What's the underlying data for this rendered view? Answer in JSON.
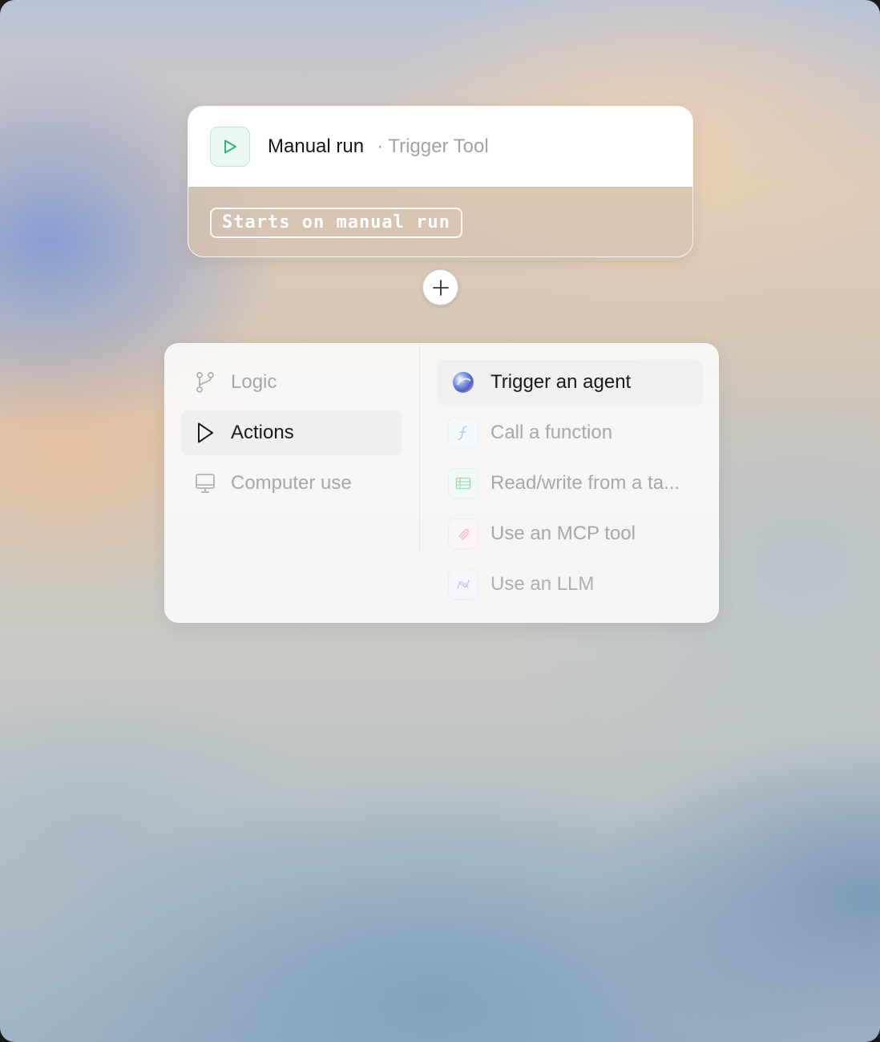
{
  "trigger": {
    "title": "Manual run",
    "separator": "·",
    "subtitle": "Trigger Tool",
    "description": "Starts on manual run",
    "icon": "play-icon",
    "accent_color": "#2bb67d"
  },
  "add_step": {
    "icon": "plus-icon"
  },
  "menu": {
    "categories": [
      {
        "label": "Logic",
        "icon": "branch-icon",
        "active": false
      },
      {
        "label": "Actions",
        "icon": "play-outline-icon",
        "active": true
      },
      {
        "label": "Computer use",
        "icon": "monitor-icon",
        "active": false
      }
    ],
    "actions": [
      {
        "label": "Trigger an agent",
        "icon": "agent-orb-icon",
        "active": true
      },
      {
        "label": "Call a function",
        "icon": "function-icon",
        "color": "#5aa9e6"
      },
      {
        "label": "Read/write from a ta...",
        "icon": "table-icon",
        "color": "#3fbf7f"
      },
      {
        "label": "Use an MCP tool",
        "icon": "mcp-icon",
        "color": "#e57a8c"
      },
      {
        "label": "Use an LLM",
        "icon": "llm-icon",
        "color": "#8f7fe0"
      }
    ]
  }
}
